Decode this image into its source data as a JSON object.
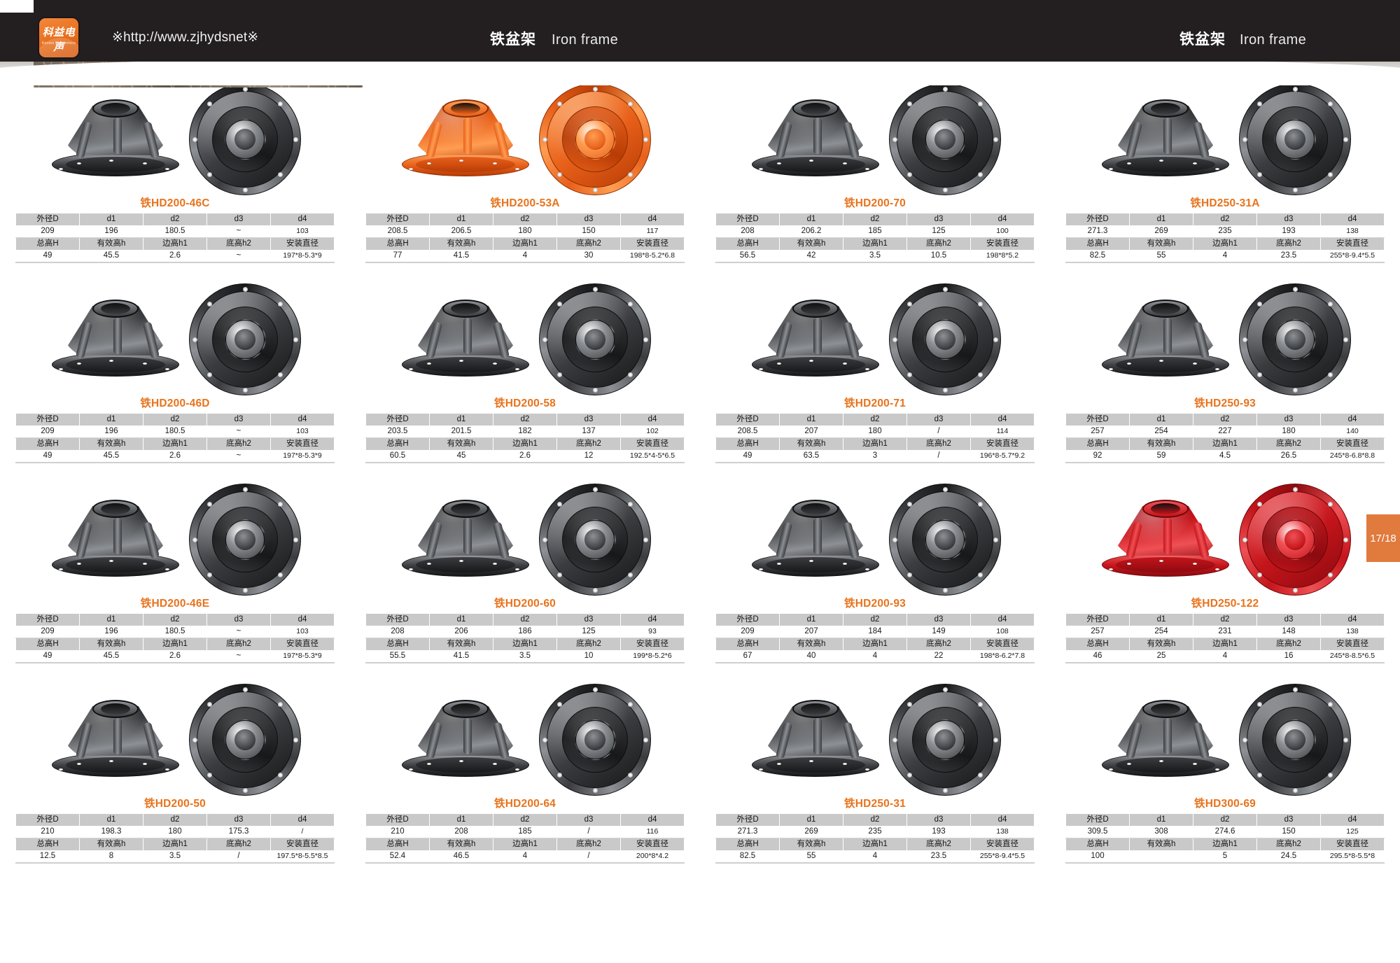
{
  "header": {
    "site_url": "※http://www.zjhydsnet※",
    "title_cn": "铁盆架",
    "title_en": "Iron frame",
    "logo_cn": "科益电声",
    "logo_en": "Kexins Electronics",
    "accent_color": "#e8731c",
    "bar_color": "#231f20"
  },
  "page_badge": "17/18",
  "table_headers": {
    "row1": [
      "外径D",
      "d1",
      "d2",
      "d3",
      "d4"
    ],
    "row2": [
      "总高H",
      "有效高h",
      "边高h1",
      "底高h2",
      "安装直径"
    ]
  },
  "products": [
    {
      "model": "铁HD200-46C",
      "color": "dark",
      "dims": [
        "209",
        "196",
        "180.5",
        "~",
        "103"
      ],
      "heights": [
        "49",
        "45.5",
        "2.6",
        "~",
        "197*8-5.3*9"
      ]
    },
    {
      "model": "铁HD200-53A",
      "color": "orange",
      "dims": [
        "208.5",
        "206.5",
        "180",
        "150",
        "117"
      ],
      "heights": [
        "77",
        "41.5",
        "4",
        "30",
        "198*8-5.2*6.8"
      ]
    },
    {
      "model": "铁HD200-70",
      "color": "dark",
      "dims": [
        "208",
        "206.2",
        "185",
        "125",
        "100"
      ],
      "heights": [
        "56.5",
        "42",
        "3.5",
        "10.5",
        "198*8*5.2"
      ]
    },
    {
      "model": "铁HD250-31A",
      "color": "dark",
      "dims": [
        "271.3",
        "269",
        "235",
        "193",
        "138"
      ],
      "heights": [
        "82.5",
        "55",
        "4",
        "23.5",
        "255*8-9.4*5.5"
      ]
    },
    {
      "model": "铁HD200-46D",
      "color": "dark",
      "dims": [
        "209",
        "196",
        "180.5",
        "~",
        "103"
      ],
      "heights": [
        "49",
        "45.5",
        "2.6",
        "~",
        "197*8-5.3*9"
      ]
    },
    {
      "model": "铁HD200-58",
      "color": "dark",
      "dims": [
        "203.5",
        "201.5",
        "182",
        "137",
        "102"
      ],
      "heights": [
        "60.5",
        "45",
        "2.6",
        "12",
        "192.5*4-5*6.5"
      ]
    },
    {
      "model": "铁HD200-71",
      "color": "dark",
      "dims": [
        "208.5",
        "207",
        "180",
        "/",
        "114"
      ],
      "heights": [
        "49",
        "63.5",
        "3",
        "/",
        "196*8-5.7*9.2"
      ]
    },
    {
      "model": "铁HD250-93",
      "color": "dark",
      "dims": [
        "257",
        "254",
        "227",
        "180",
        "140"
      ],
      "heights": [
        "92",
        "59",
        "4.5",
        "26.5",
        "245*8-6.8*8.8"
      ]
    },
    {
      "model": "铁HD200-46E",
      "color": "dark",
      "dims": [
        "209",
        "196",
        "180.5",
        "~",
        "103"
      ],
      "heights": [
        "49",
        "45.5",
        "2.6",
        "~",
        "197*8-5.3*9"
      ]
    },
    {
      "model": "铁HD200-60",
      "color": "dark",
      "dims": [
        "208",
        "206",
        "186",
        "125",
        "93"
      ],
      "heights": [
        "55.5",
        "41.5",
        "3.5",
        "10",
        "199*8-5.2*6"
      ]
    },
    {
      "model": "铁HD200-93",
      "color": "dark",
      "dims": [
        "209",
        "207",
        "184",
        "149",
        "108"
      ],
      "heights": [
        "67",
        "40",
        "4",
        "22",
        "198*8-6.2*7.8"
      ]
    },
    {
      "model": "铁HD250-122",
      "color": "red",
      "dims": [
        "257",
        "254",
        "231",
        "148",
        "138"
      ],
      "heights": [
        "46",
        "25",
        "4",
        "16",
        "245*8-8.5*6.5"
      ]
    },
    {
      "model": "铁HD200-50",
      "color": "dark",
      "dims": [
        "210",
        "198.3",
        "180",
        "175.3",
        "/"
      ],
      "heights": [
        "12.5",
        "8",
        "3.5",
        "/",
        "197.5*8-5.5*8.5"
      ]
    },
    {
      "model": "铁HD200-64",
      "color": "dark",
      "dims": [
        "210",
        "208",
        "185",
        "/",
        "116"
      ],
      "heights": [
        "52.4",
        "46.5",
        "4",
        "/",
        "200*8*4.2"
      ]
    },
    {
      "model": "铁HD250-31",
      "color": "dark",
      "dims": [
        "271.3",
        "269",
        "235",
        "193",
        "138"
      ],
      "heights": [
        "82.5",
        "55",
        "4",
        "23.5",
        "255*8-9.4*5.5"
      ]
    },
    {
      "model": "铁HD300-69",
      "color": "dark",
      "dims": [
        "309.5",
        "308",
        "274.6",
        "150",
        "125"
      ],
      "heights": [
        "100",
        "",
        "5",
        "24.5",
        "295.5*8-5.5*8"
      ]
    }
  ]
}
